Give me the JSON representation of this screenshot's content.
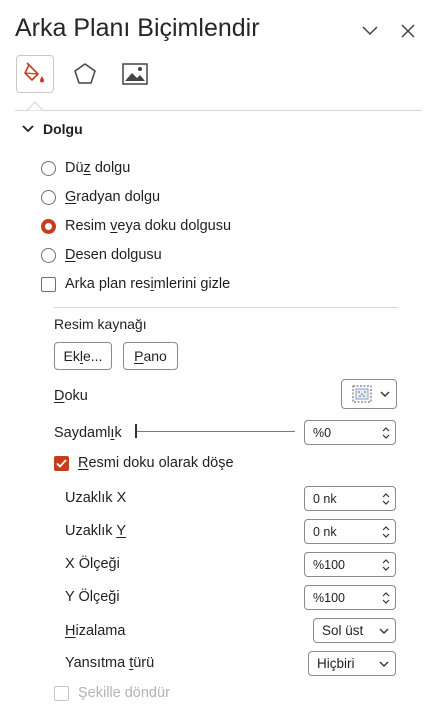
{
  "pane": {
    "title": "Arka Planı Biçimlendir"
  },
  "tabs": [
    {
      "name": "fill-effects",
      "icon": "paint-bucket-icon",
      "active": true
    },
    {
      "name": "effects",
      "icon": "pentagon-icon",
      "active": false
    },
    {
      "name": "picture",
      "icon": "picture-icon",
      "active": false
    }
  ],
  "section": {
    "title": "Dolgu"
  },
  "fill_options": [
    {
      "pre": "Dü",
      "u": "z",
      "post": " dolgu",
      "checked": false
    },
    {
      "pre": "",
      "u": "G",
      "post": "radyan dolgu",
      "checked": false
    },
    {
      "pre": "Resim ",
      "u": "v",
      "post": "eya doku dolgusu",
      "checked": true
    },
    {
      "pre": "",
      "u": "D",
      "post": "esen dolgusu",
      "checked": false
    }
  ],
  "hide_bg": {
    "pre": "Arka plan res",
    "u": "i",
    "post": "mlerini gizle",
    "checked": false
  },
  "picture_source": {
    "label": "Resim kaynağı",
    "insert_pre": "Ek",
    "insert_u": "l",
    "insert_post": "e...",
    "clipboard_u": "P",
    "clipboard_post": "ano"
  },
  "texture": {
    "label_u": "D",
    "label_post": "oku"
  },
  "transparency": {
    "pre": "Saydaml",
    "u": "ı",
    "post": "k",
    "value": "%0",
    "level": 0
  },
  "tile": {
    "pre": "",
    "u": "R",
    "post": "esmi doku olarak döşe",
    "checked": true
  },
  "offset_x": {
    "label": "Uzaklık X",
    "value": "0 nk"
  },
  "offset_y": {
    "pre": "Uzaklık ",
    "u": "Y",
    "post": "",
    "value": "0 nk"
  },
  "scale_x": {
    "label": "X Ölçeği",
    "value": "%100"
  },
  "scale_y": {
    "label": "Y Ölçeği",
    "value": "%100"
  },
  "alignment": {
    "pre": "",
    "u": "H",
    "post": "izalama",
    "value": "Sol üst"
  },
  "mirror": {
    "pre": "Yansıtma ",
    "u": "t",
    "post": "ürü",
    "value": "Hiçbiri"
  },
  "rotate": {
    "label": "Şekille döndür",
    "checked": false,
    "disabled": true
  },
  "colors": {
    "accent": "#c43e1c",
    "text": "#1f1f1f",
    "border": "#8a8a8a"
  }
}
